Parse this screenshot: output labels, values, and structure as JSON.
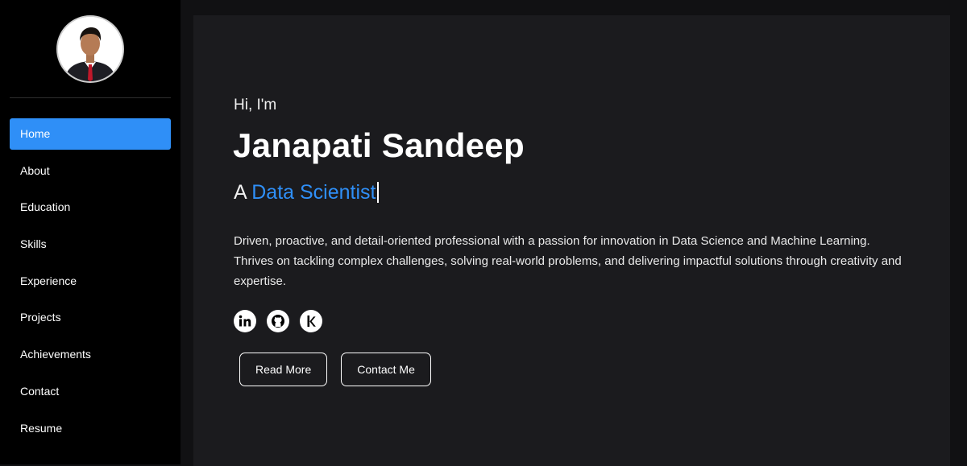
{
  "sidebar": {
    "avatar_alt": "Profile photo",
    "items": [
      {
        "label": "Home",
        "active": true
      },
      {
        "label": "About"
      },
      {
        "label": "Education"
      },
      {
        "label": "Skills"
      },
      {
        "label": "Experience"
      },
      {
        "label": "Projects"
      },
      {
        "label": "Achievements"
      },
      {
        "label": "Contact"
      },
      {
        "label": "Resume"
      }
    ]
  },
  "hero": {
    "greeting": "Hi, I'm",
    "name": "Janapati Sandeep",
    "role_prefix": "A ",
    "role": "Data Scientist",
    "bio": "Driven, proactive, and detail-oriented professional with a passion for innovation in Data Science and Machine Learning. Thrives on tackling complex challenges, solving real-world problems, and delivering impactful solutions through creativity and expertise."
  },
  "socials": [
    {
      "icon": "linkedin-icon"
    },
    {
      "icon": "github-icon"
    },
    {
      "icon": "kaggle-icon"
    }
  ],
  "buttons": {
    "read_more": "Read More",
    "contact_me": "Contact Me"
  },
  "colors": {
    "accent": "#2f8ff7",
    "sidebar_bg": "#000000",
    "page_bg": "#111113",
    "card_bg": "#1b1b1e"
  }
}
